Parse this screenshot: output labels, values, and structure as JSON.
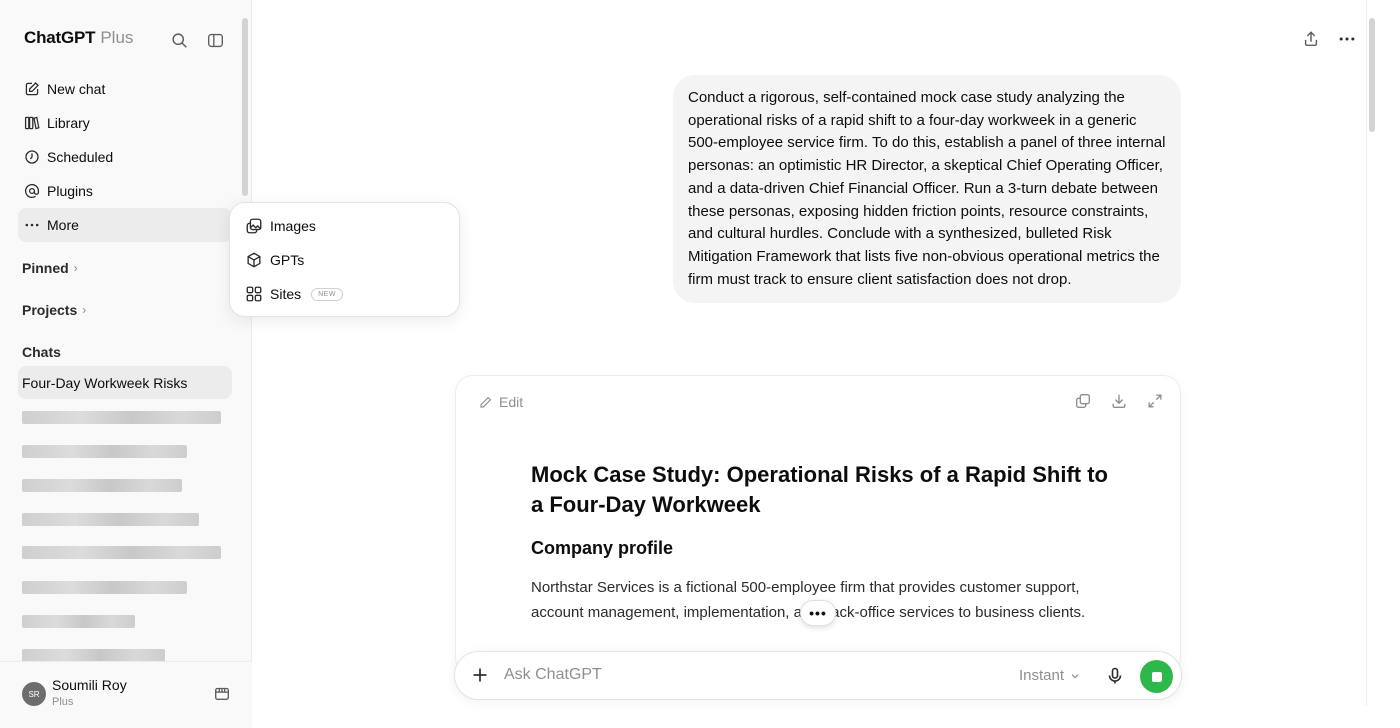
{
  "sidebar": {
    "brand": "ChatGPT",
    "brand_plan": "Plus",
    "nav": [
      {
        "label": "New chat",
        "icon": "compose-icon"
      },
      {
        "label": "Library",
        "icon": "library-icon"
      },
      {
        "label": "Scheduled",
        "icon": "clock-icon"
      },
      {
        "label": "Plugins",
        "icon": "at-icon"
      },
      {
        "label": "More",
        "icon": "ellipsis-icon"
      }
    ],
    "pinned_label": "Pinned",
    "projects_label": "Projects",
    "chats_label": "Chats",
    "active_chat": "Four-Day Workweek Risks",
    "user": {
      "initials": "SR",
      "name": "Soumili Roy",
      "plan": "Plus"
    }
  },
  "more_menu": {
    "items": [
      {
        "label": "Images",
        "icon": "images-icon"
      },
      {
        "label": "GPTs",
        "icon": "cube-icon"
      },
      {
        "label": "Sites",
        "icon": "grid-icon",
        "badge": "NEW"
      }
    ]
  },
  "conversation": {
    "user_message": "Conduct a rigorous, self-contained mock case study analyzing the operational risks of a rapid shift to a four-day workweek in a generic 500-employee service firm. To do this, establish a panel of three internal personas: an optimistic HR Director, a skeptical Chief Operating Officer, and a data-driven Chief Financial Officer. Run a 3-turn debate between these personas, exposing hidden friction points, resource constraints, and cultural hurdles. Conclude with a synthesized, bulleted Risk Mitigation Framework that lists five non-obvious operational metrics the firm must track to ensure client satisfaction does not drop.",
    "canvas": {
      "edit_label": "Edit",
      "title": "Mock Case Study: Operational Risks of a Rapid Shift to a Four-Day Workweek",
      "section_heading": "Company profile",
      "paragraph": "Northstar Services is a fictional 500-employee firm that provides customer support, account management, implementation, and back-office services to business clients."
    }
  },
  "composer": {
    "placeholder": "Ask ChatGPT",
    "model": "Instant"
  },
  "colors": {
    "accent_green": "#2eb84b",
    "sidebar_bg": "#f9f9f9",
    "bubble_bg": "#f4f4f4"
  }
}
